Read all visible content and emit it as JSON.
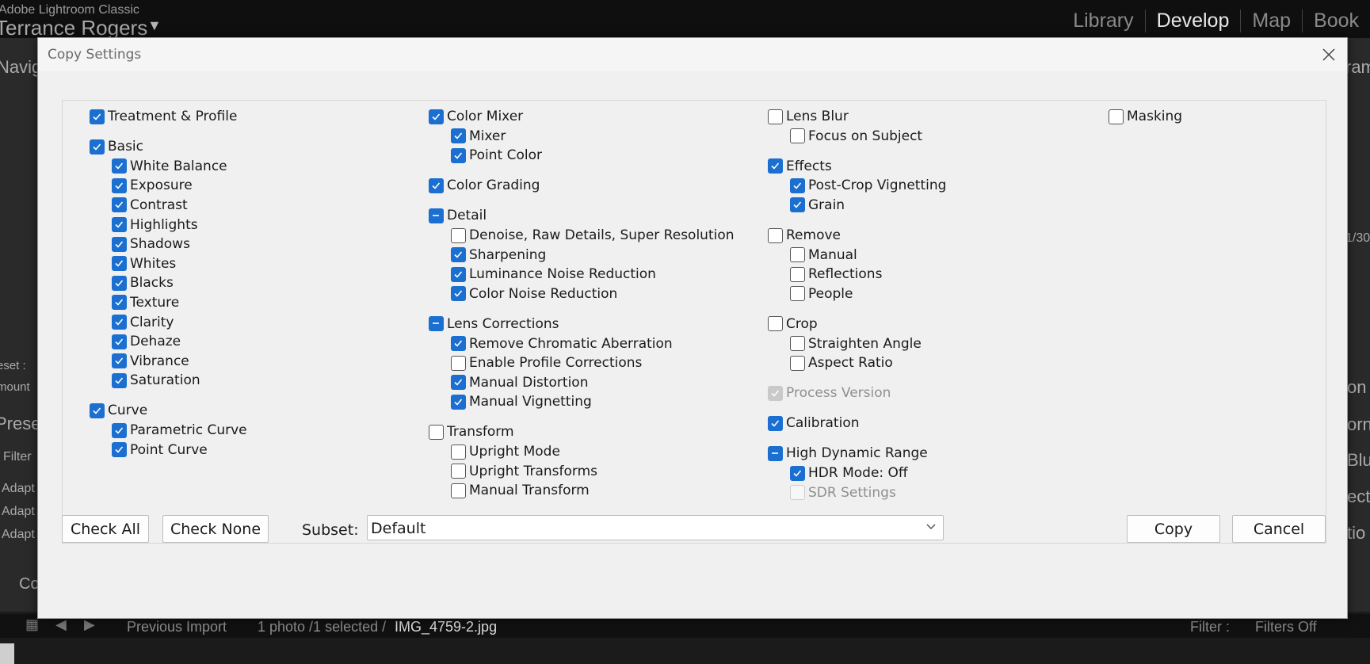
{
  "app": {
    "name": "Adobe Lightroom Classic",
    "user": "Terrance Rogers",
    "modules": [
      "Library",
      "Develop",
      "Map",
      "Book"
    ],
    "active_module": "Develop"
  },
  "background_fragments": {
    "left_panel": [
      "Navig",
      "eset :",
      "mount",
      "Preset",
      "Filter",
      "Adapt",
      "Adapt",
      "Adapt",
      "Co"
    ],
    "right_panel": [
      "ram",
      "1/30",
      "on",
      "orn",
      "Blu",
      "ect",
      "tio"
    ]
  },
  "filmstrip": {
    "source": "Previous Import",
    "count": "1 photo  /1 selected /",
    "filename": "IMG_4759-2.jpg",
    "filter_label": "Filter :",
    "filter_value": "Filters Off"
  },
  "dialog": {
    "title": "Copy Settings",
    "columns": [
      [
        {
          "label": "Treatment & Profile",
          "state": "checked",
          "indent": 0,
          "gap": 0
        },
        {
          "label": "Basic",
          "state": "checked",
          "indent": 0,
          "gap": 1
        },
        {
          "label": "White Balance",
          "state": "checked",
          "indent": 1
        },
        {
          "label": "Exposure",
          "state": "checked",
          "indent": 1
        },
        {
          "label": "Contrast",
          "state": "checked",
          "indent": 1
        },
        {
          "label": "Highlights",
          "state": "checked",
          "indent": 1
        },
        {
          "label": "Shadows",
          "state": "checked",
          "indent": 1
        },
        {
          "label": "Whites",
          "state": "checked",
          "indent": 1
        },
        {
          "label": "Blacks",
          "state": "checked",
          "indent": 1
        },
        {
          "label": "Texture",
          "state": "checked",
          "indent": 1
        },
        {
          "label": "Clarity",
          "state": "checked",
          "indent": 1
        },
        {
          "label": "Dehaze",
          "state": "checked",
          "indent": 1
        },
        {
          "label": "Vibrance",
          "state": "checked",
          "indent": 1
        },
        {
          "label": "Saturation",
          "state": "checked",
          "indent": 1
        },
        {
          "label": "Curve",
          "state": "checked",
          "indent": 0,
          "gap": 1
        },
        {
          "label": "Parametric Curve",
          "state": "checked",
          "indent": 1
        },
        {
          "label": "Point Curve",
          "state": "checked",
          "indent": 1
        }
      ],
      [
        {
          "label": "Color Mixer",
          "state": "checked",
          "indent": 0,
          "gap": 0
        },
        {
          "label": "Mixer",
          "state": "checked",
          "indent": 1
        },
        {
          "label": "Point Color",
          "state": "checked",
          "indent": 1
        },
        {
          "label": "Color Grading",
          "state": "checked",
          "indent": 0,
          "gap": 1
        },
        {
          "label": "Detail",
          "state": "mixed",
          "indent": 0,
          "gap": 1
        },
        {
          "label": "Denoise, Raw Details, Super Resolution",
          "state": "unchecked",
          "indent": 1
        },
        {
          "label": "Sharpening",
          "state": "checked",
          "indent": 1
        },
        {
          "label": "Luminance Noise Reduction",
          "state": "checked",
          "indent": 1
        },
        {
          "label": "Color Noise Reduction",
          "state": "checked",
          "indent": 1
        },
        {
          "label": "Lens Corrections",
          "state": "mixed",
          "indent": 0,
          "gap": 1
        },
        {
          "label": "Remove Chromatic Aberration",
          "state": "checked",
          "indent": 1
        },
        {
          "label": "Enable Profile Corrections",
          "state": "unchecked",
          "indent": 1
        },
        {
          "label": "Manual Distortion",
          "state": "checked",
          "indent": 1
        },
        {
          "label": "Manual Vignetting",
          "state": "checked",
          "indent": 1
        },
        {
          "label": "Transform",
          "state": "unchecked",
          "indent": 0,
          "gap": 1
        },
        {
          "label": "Upright Mode",
          "state": "unchecked",
          "indent": 1
        },
        {
          "label": "Upright Transforms",
          "state": "unchecked",
          "indent": 1
        },
        {
          "label": "Manual Transform",
          "state": "unchecked",
          "indent": 1
        }
      ],
      [
        {
          "label": "Lens Blur",
          "state": "unchecked",
          "indent": 0,
          "gap": 0
        },
        {
          "label": "Focus on Subject",
          "state": "unchecked",
          "indent": 1
        },
        {
          "label": "Effects",
          "state": "checked",
          "indent": 0,
          "gap": 1
        },
        {
          "label": "Post-Crop Vignetting",
          "state": "checked",
          "indent": 1
        },
        {
          "label": "Grain",
          "state": "checked",
          "indent": 1
        },
        {
          "label": "Remove",
          "state": "unchecked",
          "indent": 0,
          "gap": 1
        },
        {
          "label": "Manual",
          "state": "unchecked",
          "indent": 1
        },
        {
          "label": "Reflections",
          "state": "unchecked",
          "indent": 1
        },
        {
          "label": "People",
          "state": "unchecked",
          "indent": 1
        },
        {
          "label": "Crop",
          "state": "unchecked",
          "indent": 0,
          "gap": 1
        },
        {
          "label": "Straighten Angle",
          "state": "unchecked",
          "indent": 1
        },
        {
          "label": "Aspect Ratio",
          "state": "unchecked",
          "indent": 1
        },
        {
          "label": "Process Version",
          "state": "disabled-checked",
          "indent": 0,
          "gap": 1
        },
        {
          "label": "Calibration",
          "state": "checked",
          "indent": 0,
          "gap": 1
        },
        {
          "label": "High Dynamic Range",
          "state": "mixed",
          "indent": 0,
          "gap": 1
        },
        {
          "label": "HDR Mode: Off",
          "state": "checked",
          "indent": 1
        },
        {
          "label": "SDR Settings",
          "state": "disabled",
          "indent": 1
        }
      ],
      [
        {
          "label": "Masking",
          "state": "unchecked",
          "indent": 0,
          "gap": 0
        }
      ]
    ],
    "buttons": {
      "check_all": "Check All",
      "check_none": "Check None",
      "copy": "Copy",
      "cancel": "Cancel"
    },
    "subset": {
      "label": "Subset:",
      "value": "Default"
    }
  },
  "colors": {
    "checkbox_accent": "#1a6fd1",
    "dialog_bg": "#f0f0f0",
    "app_bg": "#1e1e1e"
  }
}
